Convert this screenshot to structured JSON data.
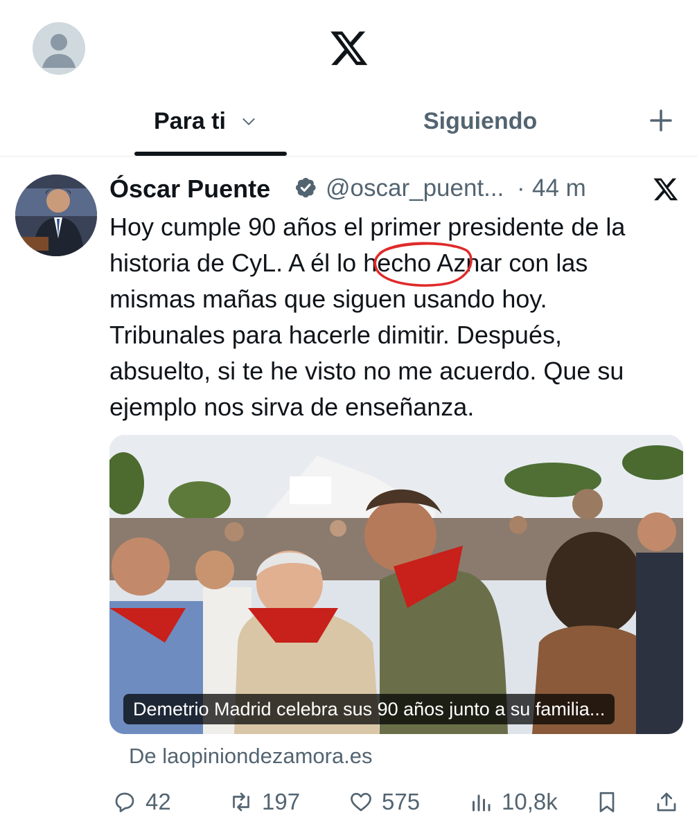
{
  "topbar": {
    "avatar_icon": "default-avatar-icon",
    "logo_icon": "x-logo-icon"
  },
  "tabs": [
    {
      "label": "Para ti",
      "active": true,
      "icon": "chevron-down-icon"
    },
    {
      "label": "Siguiendo",
      "active": false
    }
  ],
  "compose_icon": "plus-icon",
  "tweet": {
    "author_name": "Óscar Puente",
    "verified_icon": "verified-badge-icon",
    "handle": "@oscar_puent...",
    "separator": "·",
    "time": "44 m",
    "source_icon": "x-logo-icon",
    "text": "Hoy cumple 90 años el primer presidente de la\nhistoria de CyL. A él lo hecho Aznar con las\nmismas mañas que siguen usando hoy.\nTribunales para hacerle dimitir. Después,\nabsuelto, si te he visto no me acuerdo. Que su\nejemplo nos sirva de enseñanza.",
    "highlight_color": "#e02a2a",
    "media_caption": "Demetrio Madrid celebra sus 90 años junto a su familia...",
    "link_source": "De laopiniondezamora.es",
    "actions": {
      "replies": "42",
      "reposts": "197",
      "likes": "575",
      "views": "10,8k"
    }
  },
  "colors": {
    "text_primary": "#0f1419",
    "text_secondary": "#536471",
    "verified_blue": "#1d9bf0"
  }
}
